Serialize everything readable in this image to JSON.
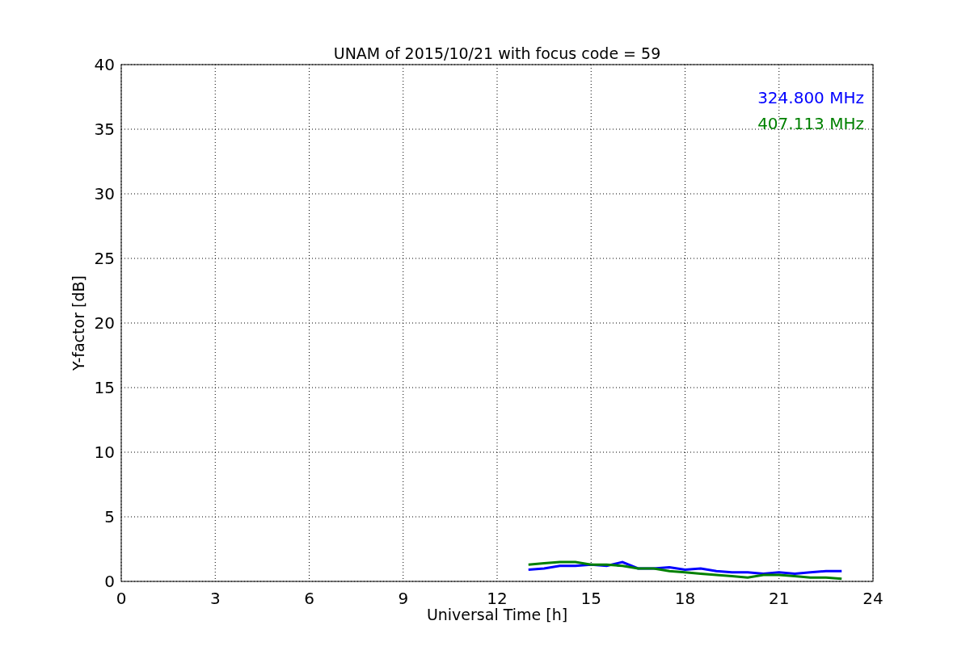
{
  "chart_data": {
    "type": "line",
    "title": "UNAM of 2015/10/21 with focus code = 59",
    "xlabel": "Universal Time [h]",
    "ylabel": "Y-factor [dB]",
    "x": [
      13,
      13.5,
      14,
      14.5,
      15,
      15.5,
      16,
      16.5,
      17,
      17.5,
      18,
      18.5,
      19,
      19.5,
      20,
      20.5,
      21,
      21.5,
      22,
      22.5,
      23
    ],
    "series": [
      {
        "name": "324.800 MHz",
        "color": "#0000ff",
        "values": [
          0.9,
          1.0,
          1.2,
          1.2,
          1.3,
          1.2,
          1.5,
          1.0,
          1.0,
          1.1,
          0.9,
          1.0,
          0.8,
          0.7,
          0.7,
          0.6,
          0.7,
          0.6,
          0.7,
          0.8,
          0.8
        ]
      },
      {
        "name": "407.113 MHz",
        "color": "#008000",
        "values": [
          1.3,
          1.4,
          1.5,
          1.5,
          1.3,
          1.3,
          1.2,
          1.0,
          1.0,
          0.8,
          0.7,
          0.6,
          0.5,
          0.4,
          0.3,
          0.5,
          0.5,
          0.4,
          0.3,
          0.3,
          0.2
        ]
      }
    ],
    "xlim": [
      0,
      24
    ],
    "ylim": [
      0,
      40
    ],
    "xticks": [
      0,
      3,
      6,
      9,
      12,
      15,
      18,
      21,
      24
    ],
    "yticks": [
      0,
      5,
      10,
      15,
      20,
      25,
      30,
      35,
      40
    ],
    "grid": true
  }
}
